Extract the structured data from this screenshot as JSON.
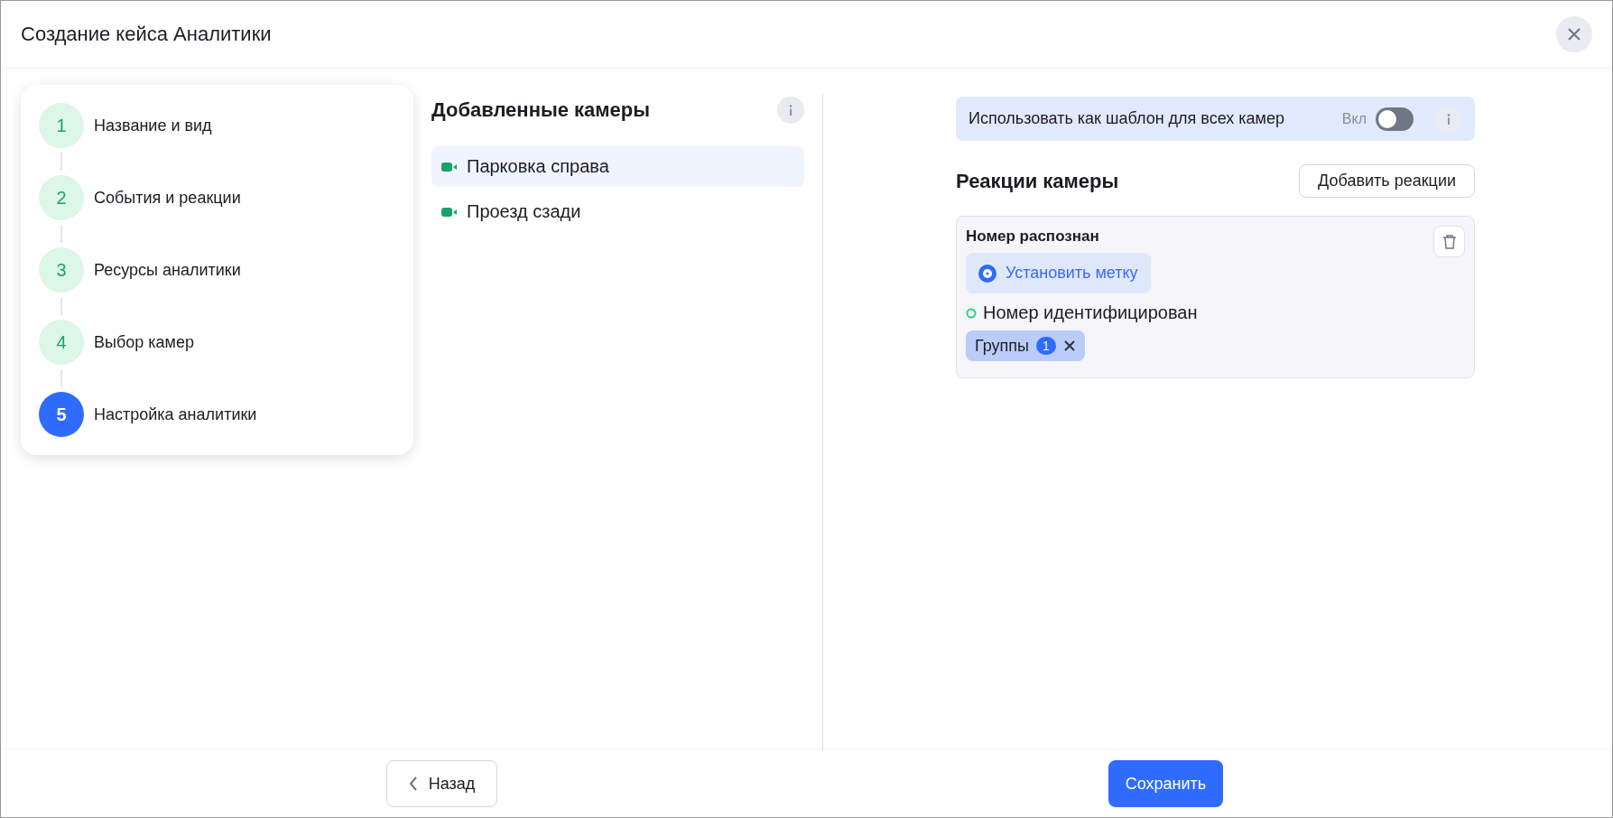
{
  "window": {
    "title": "Создание кейса Аналитики"
  },
  "steps": [
    {
      "number": "1",
      "label": "Название и вид",
      "selected": false
    },
    {
      "number": "2",
      "label": "События и реакции",
      "selected": false
    },
    {
      "number": "3",
      "label": "Ресурсы аналитики",
      "selected": false
    },
    {
      "number": "4",
      "label": "Выбор камер",
      "selected": false
    },
    {
      "number": "5",
      "label": "Настройка аналитики",
      "selected": true
    }
  ],
  "cameras": {
    "title": "Добавленные камеры",
    "items": [
      {
        "name": "Парковка справа",
        "selected": true
      },
      {
        "name": "Проезд сзади",
        "selected": false
      }
    ]
  },
  "template": {
    "label": "Использовать как шаблон для всех камер",
    "toggle_label": "Вкл",
    "on": false
  },
  "reactions": {
    "title": "Реакции камеры",
    "add_button": "Добавить реакции",
    "cards": [
      {
        "title": "Номер распознан",
        "action": "Установить метку",
        "event": "Номер идентифицирован",
        "chip": {
          "label": "Группы",
          "count": "1"
        }
      }
    ]
  },
  "footer": {
    "back": "Назад",
    "save": "Сохранить"
  }
}
